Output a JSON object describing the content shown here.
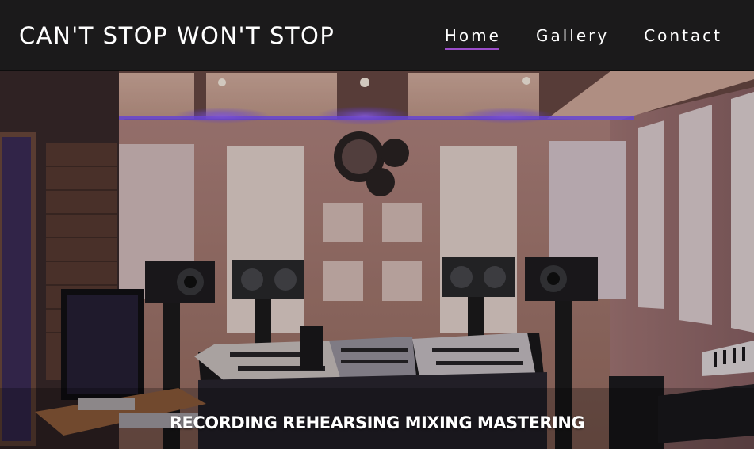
{
  "header": {
    "site_title": "CAN'T STOP WON'T STOP",
    "nav": [
      {
        "label": "Home",
        "active": true
      },
      {
        "label": "Gallery",
        "active": false
      },
      {
        "label": "Contact",
        "active": false
      }
    ],
    "accent_color": "#9b4dca",
    "background_color": "#1b1a1b"
  },
  "hero": {
    "image": "recording-studio-photo",
    "tagline": "RECORDING REHEARSING MIXING MASTERING"
  }
}
